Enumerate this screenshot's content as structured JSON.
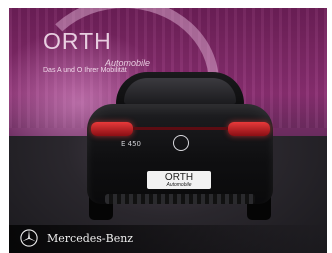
{
  "dealer": {
    "name": "ORTH",
    "suffix": "Automobile",
    "tagline": "Das A und O Ihrer Mobilität"
  },
  "car": {
    "model_badge": "E 450",
    "plate_name": "ORTH",
    "plate_sub": "Automobile"
  },
  "footer": {
    "brand": "Mercedes-Benz"
  }
}
